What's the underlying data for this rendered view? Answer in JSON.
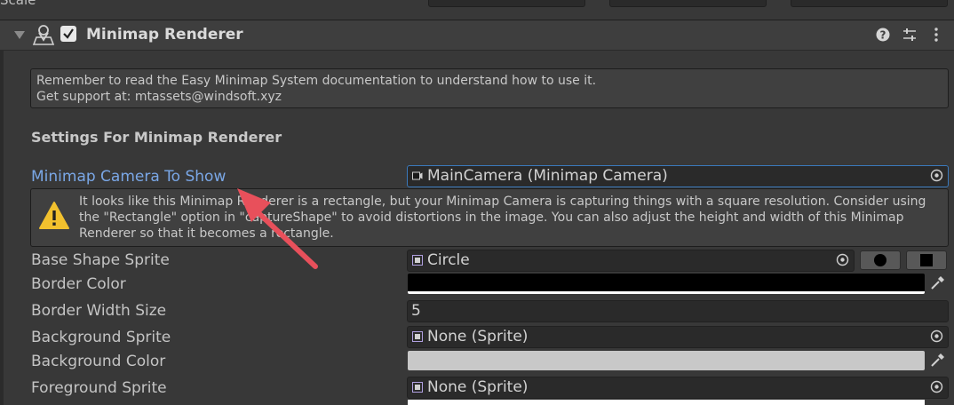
{
  "top_strip": {
    "label": "Scale"
  },
  "component": {
    "title": "Minimap Renderer",
    "enabled": true,
    "icons": {
      "component": "map-pin-person-icon",
      "help": "help-icon",
      "presets": "presets-icon",
      "menu": "kebab-menu-icon"
    }
  },
  "info": {
    "line1": "Remember to read the Easy Minimap System documentation to understand how to use it.",
    "line2": "Get support at: mtassets@windsoft.xyz"
  },
  "section_title": "Settings For Minimap Renderer",
  "fields": {
    "camera": {
      "label": "Minimap Camera To Show",
      "value": "MainCamera (Minimap Camera)"
    },
    "base_shape": {
      "label": "Base Shape Sprite",
      "value": "Circle"
    },
    "border_color": {
      "label": "Border Color",
      "color": "#000000"
    },
    "border_width": {
      "label": "Border Width Size",
      "value": "5"
    },
    "bg_sprite": {
      "label": "Background Sprite",
      "value": "None (Sprite)"
    },
    "bg_color": {
      "label": "Background Color",
      "color": "#c8c8c8"
    },
    "fg_sprite": {
      "label": "Foreground Sprite",
      "value": "None (Sprite)"
    }
  },
  "warning": {
    "text": "It looks like this Minimap Renderer is a rectangle, but your Minimap Camera is capturing things with a square resolution. Consider using the \"Rectangle\" option in \"captureShape\" to avoid distortions in the image. You can also adjust the height and width of this Minimap Renderer so that it becomes a rectangle."
  },
  "annotation": {
    "arrow_color": "#e8505b"
  },
  "colors": {
    "accent": "#3a79bb",
    "link": "#7aa7e6",
    "warning": "#f2c12e"
  }
}
